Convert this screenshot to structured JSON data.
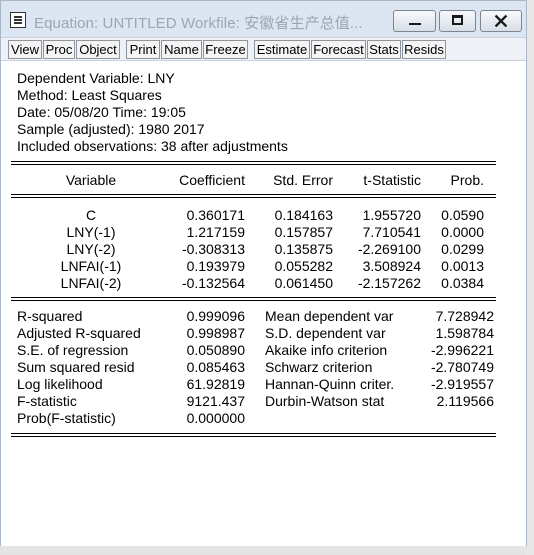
{
  "window": {
    "title": "Equation: UNTITLED   Workfile: 安徽省生产总值..."
  },
  "toolbar": {
    "buttons": [
      "View",
      "Proc",
      "Object",
      "Print",
      "Name",
      "Freeze",
      "Estimate",
      "Forecast",
      "Stats",
      "Resids"
    ]
  },
  "header": {
    "dependent": "Dependent Variable: LNY",
    "method": "Method: Least Squares",
    "date": "Date: 05/08/20   Time: 19:05",
    "sample": "Sample (adjusted): 1980 2017",
    "observations": "Included observations: 38 after adjustments"
  },
  "table": {
    "columns": [
      "Variable",
      "Coefficient",
      "Std. Error",
      "t-Statistic",
      "Prob."
    ],
    "rows": [
      [
        "C",
        "0.360171",
        "0.184163",
        "1.955720",
        "0.0590"
      ],
      [
        "LNY(-1)",
        "1.217159",
        "0.157857",
        "7.710541",
        "0.0000"
      ],
      [
        "LNY(-2)",
        "-0.308313",
        "0.135875",
        "-2.269100",
        "0.0299"
      ],
      [
        "LNFAI(-1)",
        "0.193979",
        "0.055282",
        "3.508924",
        "0.0013"
      ],
      [
        "LNFAI(-2)",
        "-0.132564",
        "0.061450",
        "-2.157262",
        "0.0384"
      ]
    ]
  },
  "stats": {
    "left": [
      [
        "R-squared",
        "0.999096"
      ],
      [
        "Adjusted R-squared",
        "0.998987"
      ],
      [
        "S.E. of regression",
        "0.050890"
      ],
      [
        "Sum squared resid",
        "0.085463"
      ],
      [
        "Log likelihood",
        "61.92819"
      ],
      [
        "F-statistic",
        "9121.437"
      ],
      [
        "Prob(F-statistic)",
        "0.000000"
      ]
    ],
    "right": [
      [
        "Mean dependent var",
        "7.728942"
      ],
      [
        "S.D. dependent var",
        "1.598784"
      ],
      [
        "Akaike info criterion",
        "-2.996221"
      ],
      [
        "Schwarz criterion",
        "-2.780749"
      ],
      [
        "Hannan-Quinn criter.",
        "-2.919557"
      ],
      [
        "Durbin-Watson stat",
        "2.119566"
      ]
    ]
  }
}
